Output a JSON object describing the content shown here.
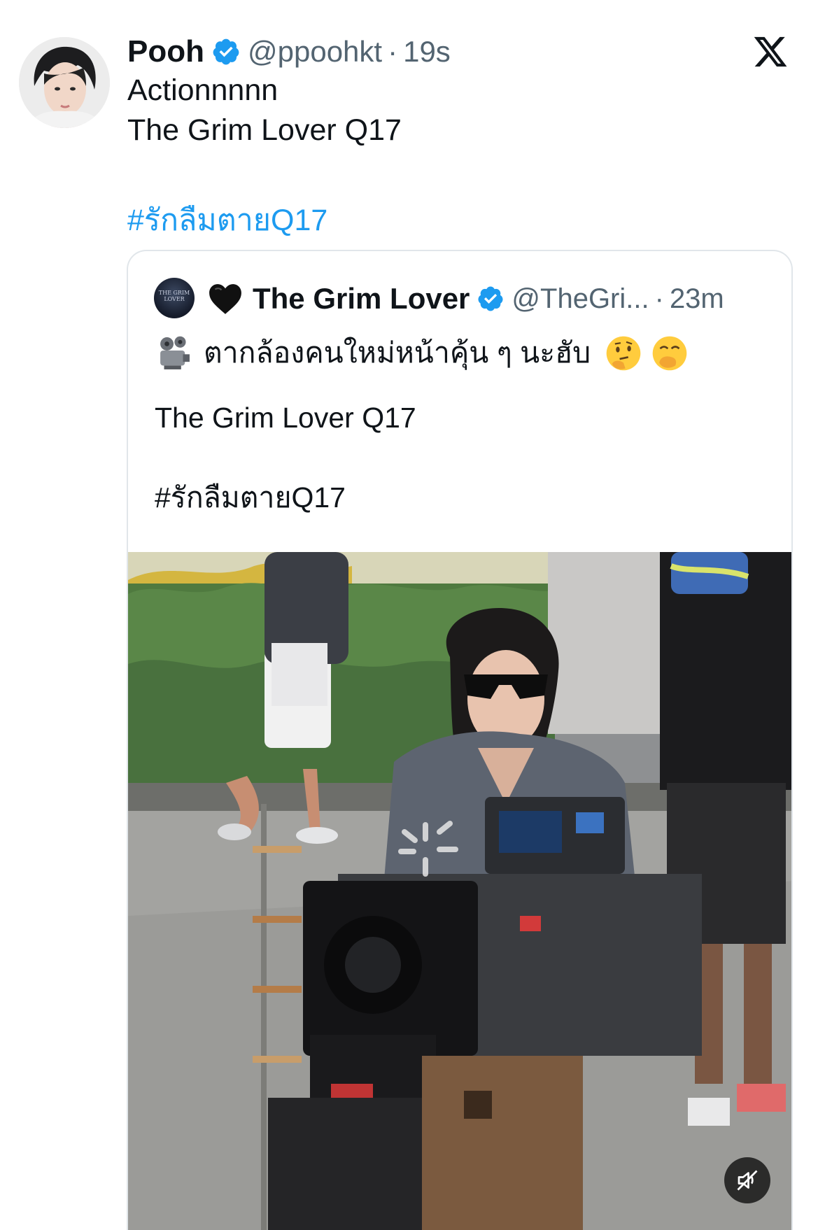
{
  "tweet": {
    "author_name": "Pooh",
    "handle": "@ppoohkt",
    "separator": "·",
    "time": "19s",
    "lines": [
      "Actionnnnn",
      "The Grim Lover Q17"
    ],
    "hashtag": "#รักลืมตายQ17"
  },
  "quoted": {
    "emoji_heart": "black-heart",
    "author_name": "The Grim Lover",
    "handle": "@TheGri...",
    "separator": "·",
    "time": "23m",
    "text_thai": "ตากล้องคนใหม่หน้าคุ้น ๆ นะฮับ",
    "avatar_text": "THE GRIM LOVER",
    "line2": "The Grim Lover Q17",
    "hashtag": "#รักลืมตายQ17",
    "media": "video",
    "muted": true
  },
  "colors": {
    "link": "#1d9bf0",
    "verified": "#1d9bf0",
    "secondary_text": "#536471",
    "border": "#e1e6ea"
  },
  "icons": [
    "x-logo-icon",
    "verified-badge-icon",
    "black-heart-icon",
    "film-projector-icon",
    "thinking-face-icon",
    "face-with-hand-over-mouth-icon",
    "mute-icon"
  ]
}
